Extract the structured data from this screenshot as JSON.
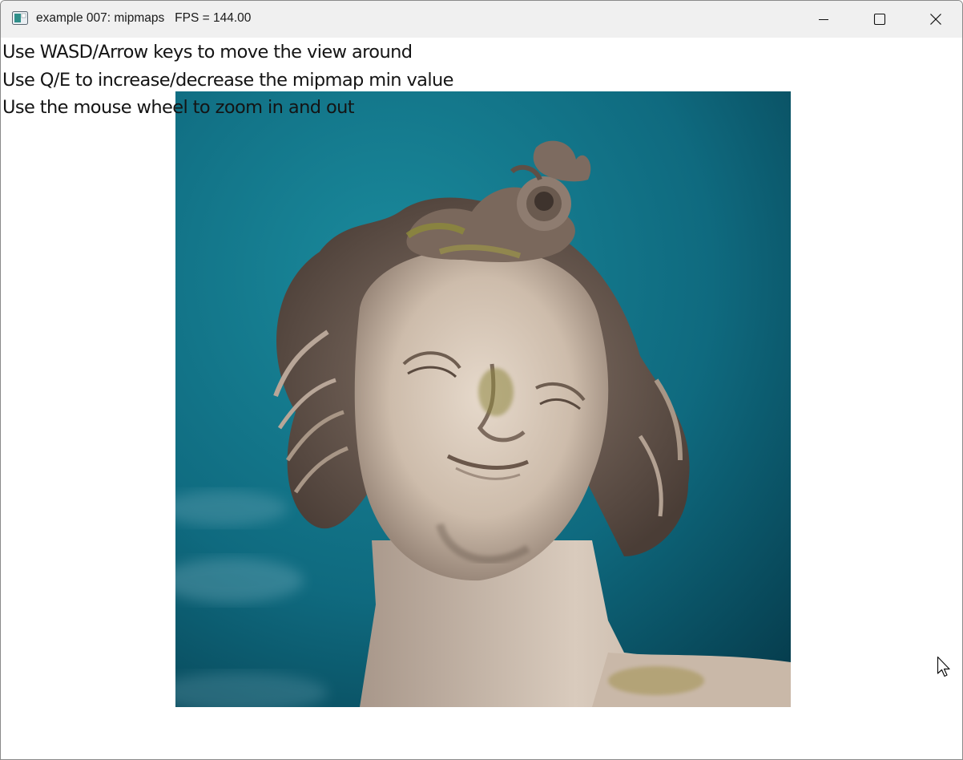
{
  "window": {
    "title": "example 007: mipmaps",
    "fps_label": "FPS = 144.00",
    "app_icon": "app-window-icon",
    "controls": {
      "minimize_icon": "minimize-icon",
      "maximize_icon": "maximize-icon",
      "close_icon": "close-icon"
    }
  },
  "instructions": [
    "Use WASD/Arrow keys to move the view around",
    "Use Q/E to increase/decrease the mipmap min value",
    "Use the mouse wheel to zoom in and out"
  ],
  "viewport": {
    "texture_subject": "statue head against teal sky",
    "sky_color": "#0c5f73",
    "stone_color": "#d6c7b9"
  },
  "cursor_icon": "mouse-pointer-icon"
}
